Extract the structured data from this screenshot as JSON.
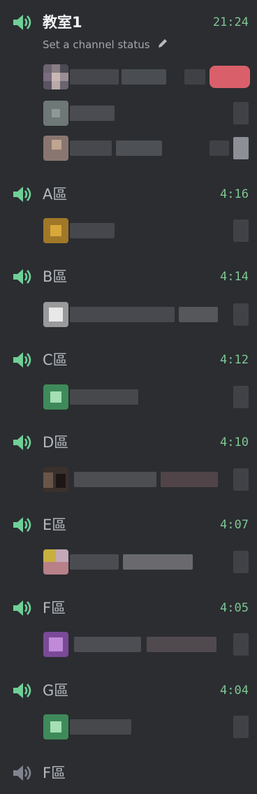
{
  "channels": [
    {
      "name": "教室1",
      "time": "21:24",
      "status": "Set a channel status",
      "active": true
    },
    {
      "name": "A區",
      "time": "4:16"
    },
    {
      "name": "B區",
      "time": "4:14"
    },
    {
      "name": "C區",
      "time": "4:12"
    },
    {
      "name": "D區",
      "time": "4:10"
    },
    {
      "name": "E區",
      "time": "4:07"
    },
    {
      "name": "F區",
      "time": "4:05"
    },
    {
      "name": "G區",
      "time": "4:04"
    },
    {
      "name": "F區",
      "time": ""
    }
  ],
  "colors": {
    "background": "#2b2d31",
    "speaker_active": "#6fcf97",
    "speaker_inactive": "#80848e",
    "timer": "#7ec793"
  }
}
